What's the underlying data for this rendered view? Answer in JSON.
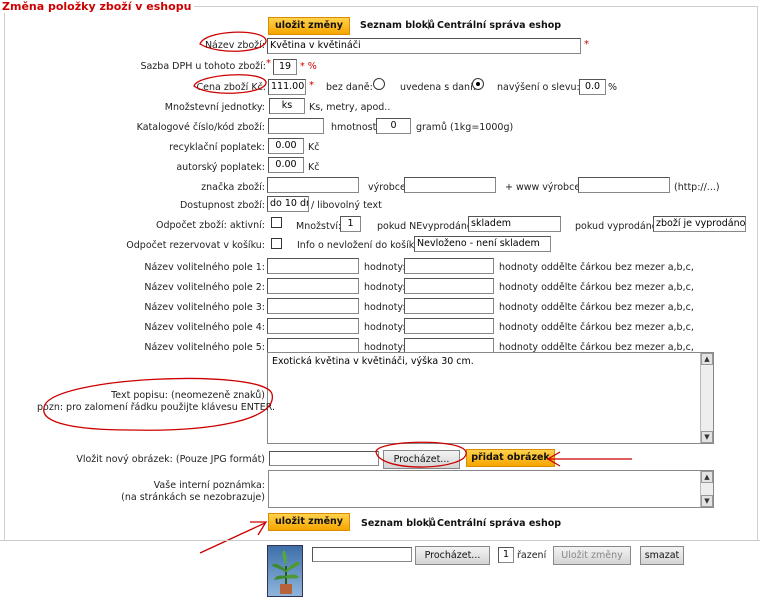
{
  "title": "Změna položky zboží v eshopu",
  "top_nav": {
    "save": "uložit změny",
    "blocks": "Seznam bloků",
    "sep": "|",
    "central": "Centrální správa eshop"
  },
  "form": {
    "name_label": "Název zboží:",
    "name_value": "Květina v květináči",
    "vat_label": "Sazba DPH u tohoto zboží:",
    "vat_value": "19",
    "vat_unit": "* %",
    "price_label": "Cena zboží Kč:",
    "price_value": "111.00",
    "without_vat": "bez daně:",
    "with_vat": "uvedena s daní:",
    "discount_label": "navýšení o slevu:",
    "discount_value": "0.0",
    "discount_unit": "%",
    "qty_unit_label": "Množstevní jednotky:",
    "qty_unit_value": "ks",
    "qty_unit_hint": "Ks, metry, apod..",
    "catalog_label": "Katalogové číslo/kód zboží:",
    "catalog_value": "",
    "weight_label": "hmotnost:",
    "weight_value": "0",
    "weight_unit": "gramů (1kg=1000g)",
    "recycle_label": "recyklační poplatek:",
    "recycle_value": "0.00",
    "recycle_unit": "Kč",
    "author_label": "autorský poplatek:",
    "author_value": "0.00",
    "author_unit": "Kč",
    "brand_label": "značka zboží:",
    "brand_value": "",
    "maker_label": "výrobce",
    "maker_value": "",
    "www_label": "+ www výrobce",
    "www_value": "",
    "www_hint": "(http://...)",
    "avail_label": "Dostupnost zboží:",
    "avail_value": "do 10 dn",
    "avail_hint": "/ libovolný text",
    "stock_active_label": "Odpočet zboží: aktivní:",
    "stock_qty_label": "Množství:",
    "stock_qty_value": "1",
    "not_sold_out_label": "pokud NEvyprodáno:",
    "not_sold_out_value": "skladem",
    "sold_out_label": "pokud vyprodáno:",
    "sold_out_value": "zboží je vyprodáno:",
    "reserve_label": "Odpočet rezervovat v košíku:",
    "not_added_label": "Info o nevložení do košíku:",
    "not_added_value": "Nevloženo - není skladem",
    "optional_fields": [
      {
        "label": "Název volitelného pole 1:"
      },
      {
        "label": "Název volitelného pole 2:"
      },
      {
        "label": "Název volitelného pole 3:"
      },
      {
        "label": "Název volitelného pole 4:"
      },
      {
        "label": "Název volitelného pole 5:"
      }
    ],
    "values_label": "hodnoty:",
    "values_hint": "hodnoty oddělte čárkou bez mezer a,b,c,",
    "desc_label_1": "Text popisu: (neomezeně znaků)",
    "desc_label_2": "pozn: pro zalomení řádku použijte klávesu ENTER.",
    "desc_value": "Exotická květina v květináči, výška 30 cm.",
    "image_label": "Vložit nový obrázek: (Pouze JPG formát)",
    "browse": "Procházet...",
    "add_image": "přidat obrázek",
    "note_label_1": "Vaše interní poznámka:",
    "note_label_2": "(na stránkách se nezobrazuje)"
  },
  "bottom_nav": {
    "save": "uložit změny",
    "blocks": "Seznam bloků",
    "sep": "|",
    "central": "Centrální správa eshop"
  },
  "image_row": {
    "browse": "Procházet...",
    "order_value": "1",
    "order_label": "řazení",
    "save": "Uložit změny",
    "delete": "smazat"
  },
  "colors": {
    "title": "#cc0000",
    "annotation": "#cc0000",
    "button": "#f6a500"
  }
}
